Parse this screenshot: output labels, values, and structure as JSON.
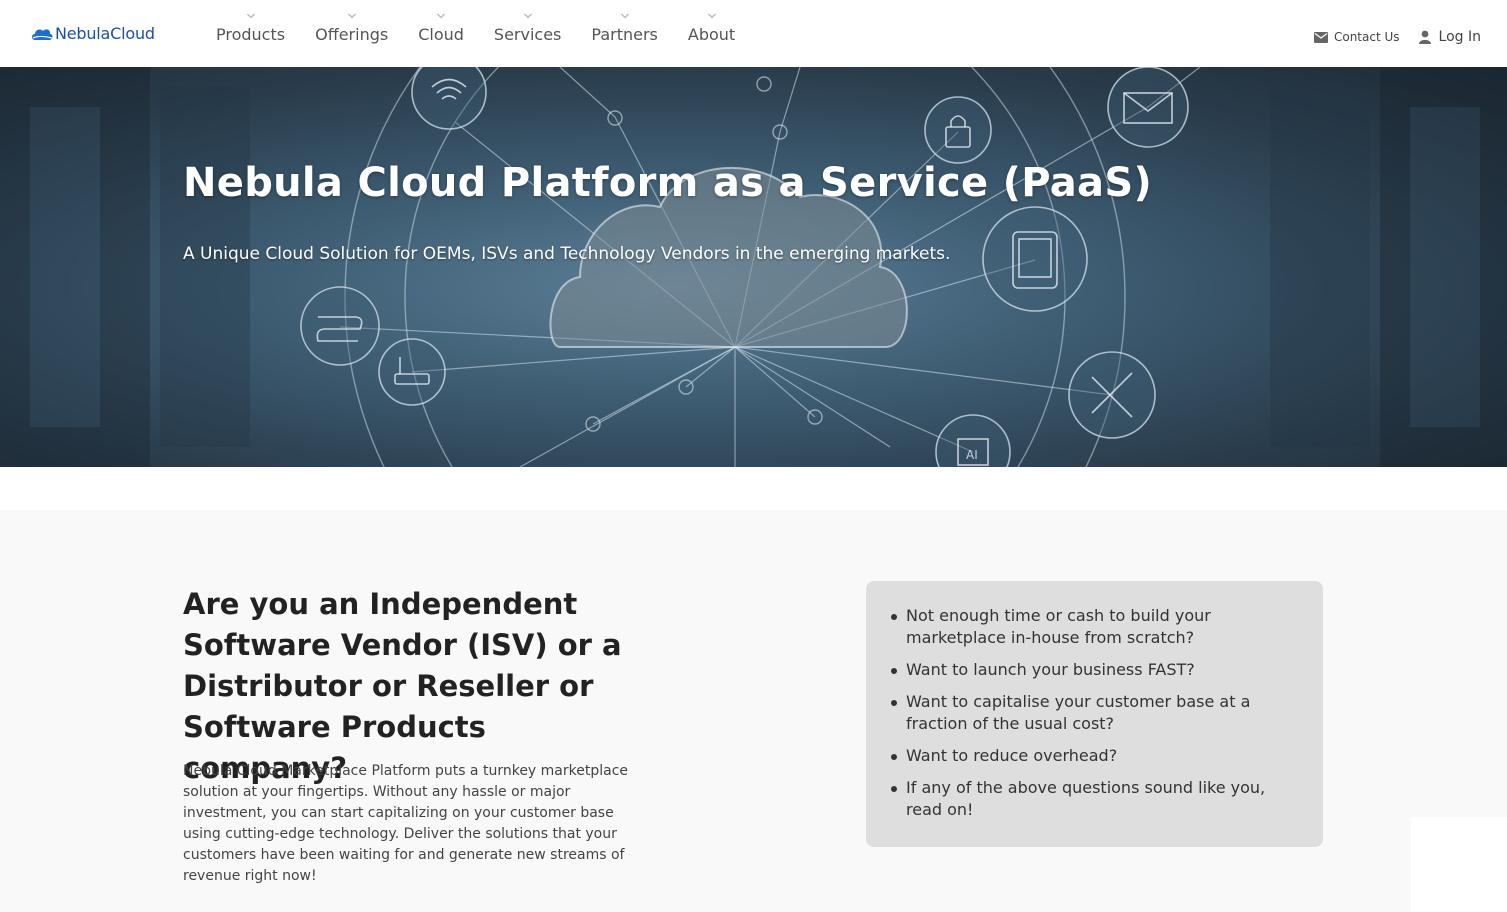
{
  "header": {
    "logo_text": "NebulaCloud",
    "nav": [
      {
        "label": "Products"
      },
      {
        "label": "Offerings"
      },
      {
        "label": "Cloud"
      },
      {
        "label": "Services"
      },
      {
        "label": "Partners"
      },
      {
        "label": "About"
      }
    ],
    "contact_label": "Contact Us",
    "login_label": "Log In"
  },
  "hero": {
    "title": "Nebula Cloud Platform as a Service (PaaS)",
    "subtitle": "A Unique Cloud Solution for OEMs, ISVs and Technology Vendors in the emerging markets.",
    "chip_label": "AI"
  },
  "section": {
    "title": "Are you an Independent Software Vendor (ISV) or a Distributor or Reseller or Software Products company?",
    "body": "Nebula Cloud Marketplace Platform puts a turnkey marketplace solution at your fingertips. Without any hassle or major investment, you can start capitalizing on your customer base using cutting-edge technology. Deliver the solutions that your customers have been waiting for and generate new streams of revenue right now!",
    "bullets": [
      "Not enough time or cash to build your marketplace in-house from scratch?",
      "Want to launch your business FAST?",
      "Want to capitalise your customer base at a fraction of the usual cost?",
      "Want to reduce overhead?",
      "If any of the above questions sound like you, read on!"
    ]
  },
  "colors": {
    "brand": "#1b4fa8",
    "section_bg": "#f9f9f9",
    "box_bg": "#dedede"
  }
}
